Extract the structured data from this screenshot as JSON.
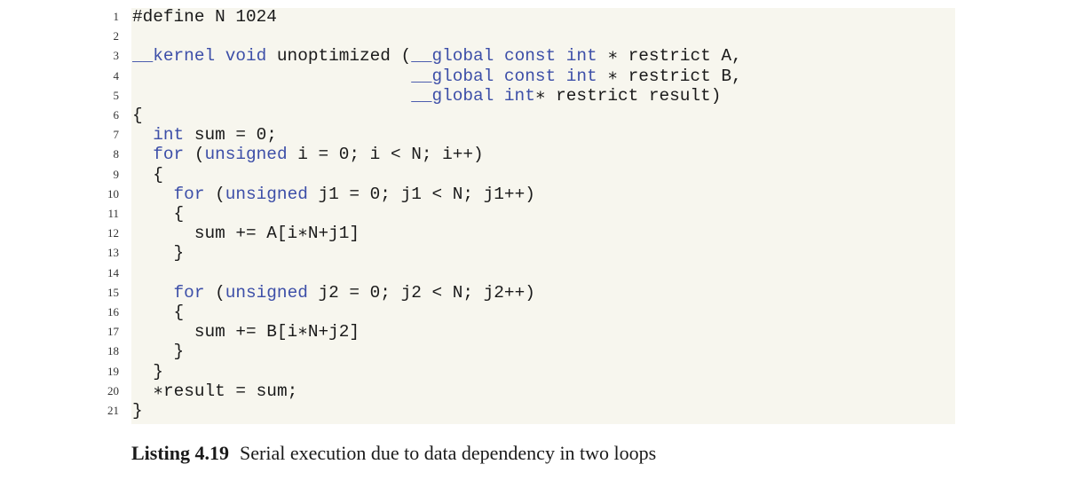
{
  "code": {
    "lines": [
      {
        "num": "1",
        "tokens": [
          {
            "t": "#define N 1024",
            "k": false
          }
        ]
      },
      {
        "num": "2",
        "tokens": []
      },
      {
        "num": "3",
        "tokens": [
          {
            "t": "__kernel",
            "k": true
          },
          {
            "t": " ",
            "k": false
          },
          {
            "t": "void",
            "k": true
          },
          {
            "t": " unoptimized (",
            "k": false
          },
          {
            "t": "__global",
            "k": true
          },
          {
            "t": " ",
            "k": false
          },
          {
            "t": "const",
            "k": true
          },
          {
            "t": " ",
            "k": false
          },
          {
            "t": "int",
            "k": true
          },
          {
            "t": " ∗ restrict A,",
            "k": false
          }
        ]
      },
      {
        "num": "4",
        "tokens": [
          {
            "t": "                           ",
            "k": false
          },
          {
            "t": "__global",
            "k": true
          },
          {
            "t": " ",
            "k": false
          },
          {
            "t": "const",
            "k": true
          },
          {
            "t": " ",
            "k": false
          },
          {
            "t": "int",
            "k": true
          },
          {
            "t": " ∗ restrict B,",
            "k": false
          }
        ]
      },
      {
        "num": "5",
        "tokens": [
          {
            "t": "                           ",
            "k": false
          },
          {
            "t": "__global",
            "k": true
          },
          {
            "t": " ",
            "k": false
          },
          {
            "t": "int",
            "k": true
          },
          {
            "t": "∗ restrict result)",
            "k": false
          }
        ]
      },
      {
        "num": "6",
        "tokens": [
          {
            "t": "{",
            "k": false
          }
        ]
      },
      {
        "num": "7",
        "tokens": [
          {
            "t": "  ",
            "k": false
          },
          {
            "t": "int",
            "k": true
          },
          {
            "t": " sum = 0;",
            "k": false
          }
        ]
      },
      {
        "num": "8",
        "tokens": [
          {
            "t": "  ",
            "k": false
          },
          {
            "t": "for",
            "k": true
          },
          {
            "t": " (",
            "k": false
          },
          {
            "t": "unsigned",
            "k": true
          },
          {
            "t": " i = 0; i < N; i++)",
            "k": false
          }
        ]
      },
      {
        "num": "9",
        "tokens": [
          {
            "t": "  {",
            "k": false
          }
        ]
      },
      {
        "num": "10",
        "tokens": [
          {
            "t": "    ",
            "k": false
          },
          {
            "t": "for",
            "k": true
          },
          {
            "t": " (",
            "k": false
          },
          {
            "t": "unsigned",
            "k": true
          },
          {
            "t": " j1 = 0; j1 < N; j1++)",
            "k": false
          }
        ]
      },
      {
        "num": "11",
        "tokens": [
          {
            "t": "    {",
            "k": false
          }
        ]
      },
      {
        "num": "12",
        "tokens": [
          {
            "t": "      sum += A[i∗N+j1]",
            "k": false
          }
        ]
      },
      {
        "num": "13",
        "tokens": [
          {
            "t": "    }",
            "k": false
          }
        ]
      },
      {
        "num": "14",
        "tokens": []
      },
      {
        "num": "15",
        "tokens": [
          {
            "t": "    ",
            "k": false
          },
          {
            "t": "for",
            "k": true
          },
          {
            "t": " (",
            "k": false
          },
          {
            "t": "unsigned",
            "k": true
          },
          {
            "t": " j2 = 0; j2 < N; j2++)",
            "k": false
          }
        ]
      },
      {
        "num": "16",
        "tokens": [
          {
            "t": "    {",
            "k": false
          }
        ]
      },
      {
        "num": "17",
        "tokens": [
          {
            "t": "      sum += B[i∗N+j2]",
            "k": false
          }
        ]
      },
      {
        "num": "18",
        "tokens": [
          {
            "t": "    }",
            "k": false
          }
        ]
      },
      {
        "num": "19",
        "tokens": [
          {
            "t": "  }",
            "k": false
          }
        ]
      },
      {
        "num": "20",
        "tokens": [
          {
            "t": "  ∗result = sum;",
            "k": false
          }
        ]
      },
      {
        "num": "21",
        "tokens": [
          {
            "t": "}",
            "k": false
          }
        ]
      }
    ]
  },
  "caption": {
    "label": "Listing 4.19",
    "text": "Serial execution due to data dependency in two loops"
  }
}
